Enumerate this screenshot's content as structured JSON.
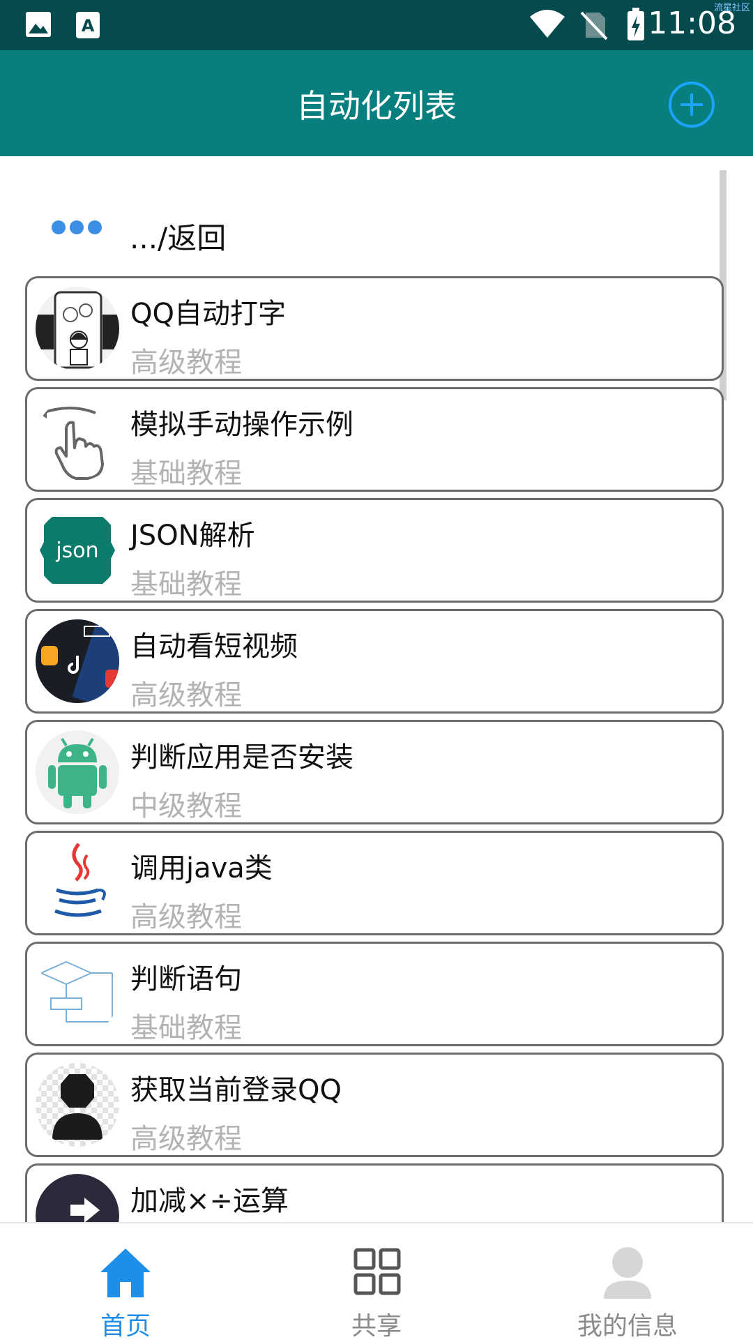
{
  "status_bar": {
    "time": "11:08",
    "tag": "流星社区",
    "icons": [
      "image-icon",
      "text-a-icon",
      "wifi-icon",
      "no-sim-icon",
      "battery-charging-icon"
    ]
  },
  "appbar": {
    "title": "自动化列表",
    "add_icon": "plus-circle-icon"
  },
  "back_row": {
    "label": ".../返回",
    "icon": "three-dots-icon"
  },
  "items": [
    {
      "title": "QQ自动打字",
      "subtitle": "高级教程",
      "icon": "typing-comic-icon"
    },
    {
      "title": "模拟手动操作示例",
      "subtitle": "基础教程",
      "icon": "hand-swipe-icon"
    },
    {
      "title": "JSON解析",
      "subtitle": "基础教程",
      "icon": "json-badge-icon",
      "icon_text": "json"
    },
    {
      "title": "自动看短视频",
      "subtitle": "高级教程",
      "icon": "short-video-apps-icon"
    },
    {
      "title": "判断应用是否安装",
      "subtitle": "中级教程",
      "icon": "android-robot-icon"
    },
    {
      "title": "调用java类",
      "subtitle": "高级教程",
      "icon": "java-cup-icon"
    },
    {
      "title": "判断语句",
      "subtitle": "基础教程",
      "icon": "flowchart-icon"
    },
    {
      "title": "获取当前登录QQ",
      "subtitle": "高级教程",
      "icon": "user-silhouette-icon"
    },
    {
      "title": "加减×÷运算",
      "subtitle": "",
      "icon": "arrow-circle-icon"
    }
  ],
  "bottom_nav": [
    {
      "label": "首页",
      "icon": "home-icon",
      "active": true
    },
    {
      "label": "共享",
      "icon": "grid-icon",
      "active": false
    },
    {
      "label": "我的信息",
      "icon": "person-icon",
      "active": false
    }
  ],
  "colors": {
    "status_bar": "#054a4c",
    "appbar": "#077f7f",
    "accent": "#2196f3",
    "inactive": "#8a8a8a"
  }
}
